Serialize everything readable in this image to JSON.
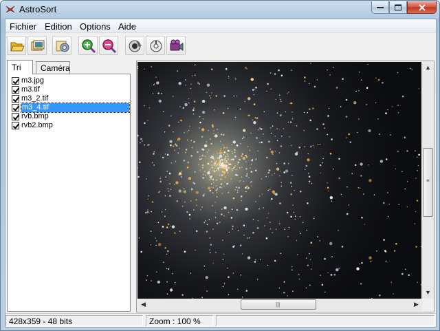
{
  "window": {
    "title": "AstroSort"
  },
  "menu": {
    "items": [
      "Fichier",
      "Edition",
      "Options",
      "Aide"
    ]
  },
  "toolbar": {
    "buttons": [
      {
        "icon": "open-folder-icon"
      },
      {
        "icon": "open-images-icon"
      },
      {
        "icon": "settings-icon"
      },
      {
        "icon": "zoom-in-icon"
      },
      {
        "icon": "zoom-out-icon"
      },
      {
        "icon": "camera-icon"
      },
      {
        "icon": "disc-icon"
      },
      {
        "icon": "video-icon"
      }
    ]
  },
  "tabs": [
    "Tri",
    "Caméra"
  ],
  "active_tab": "Tri",
  "files": [
    {
      "name": "m3.jpg",
      "checked": true
    },
    {
      "name": "m3.tif",
      "checked": true
    },
    {
      "name": "m3_2.tif",
      "checked": true
    },
    {
      "name": "m3_4.tif",
      "checked": true,
      "selected": true
    },
    {
      "name": "rvb.bmp",
      "checked": true
    },
    {
      "name": "rvb2.bmp",
      "checked": true
    }
  ],
  "status": {
    "image_info": "428x359 - 48 bits",
    "zoom": "Zoom : 100 %"
  },
  "colors": {
    "selection": "#3399ff",
    "sky": "#0c0d10",
    "cluster_core": "#b8b08a"
  }
}
